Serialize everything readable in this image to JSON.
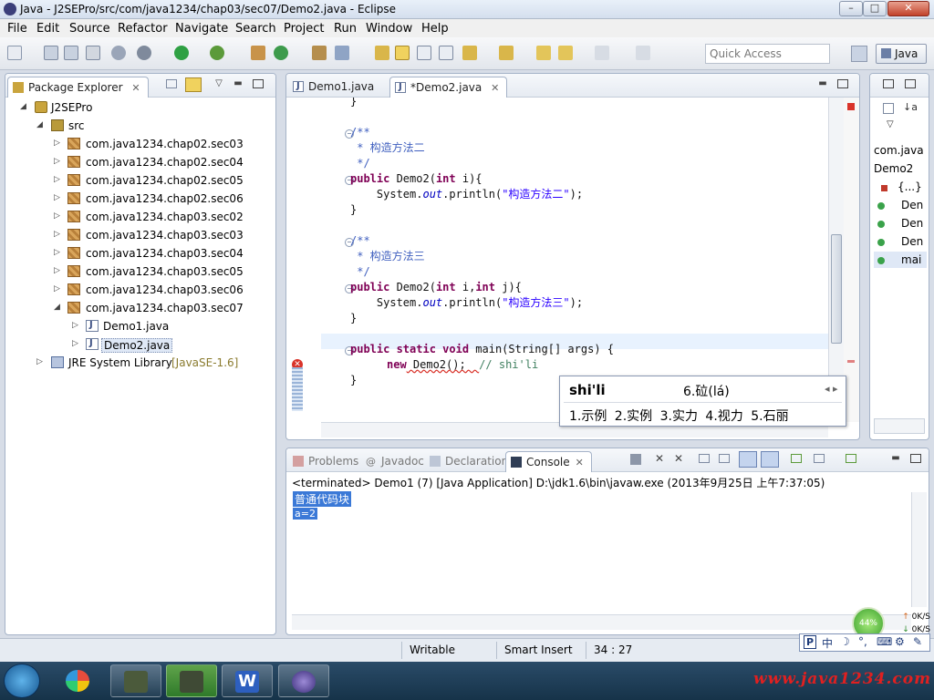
{
  "window": {
    "title": "Java - J2SEPro/src/com/java1234/chap03/sec07/Demo2.java - Eclipse",
    "minimize": "–",
    "maximize": "□",
    "close": "✕"
  },
  "menu": [
    "File",
    "Edit",
    "Source",
    "Refactor",
    "Navigate",
    "Search",
    "Project",
    "Run",
    "Window",
    "Help"
  ],
  "toolbar": {
    "quick_access_placeholder": "Quick Access",
    "perspective": "Java"
  },
  "package_explorer": {
    "tab_label": "Package Explorer",
    "tree": [
      {
        "label": "J2SEPro"
      },
      {
        "label": "src"
      },
      {
        "label": "com.java1234.chap02.sec03"
      },
      {
        "label": "com.java1234.chap02.sec04"
      },
      {
        "label": "com.java1234.chap02.sec05"
      },
      {
        "label": "com.java1234.chap02.sec06"
      },
      {
        "label": "com.java1234.chap03.sec02"
      },
      {
        "label": "com.java1234.chap03.sec03"
      },
      {
        "label": "com.java1234.chap03.sec04"
      },
      {
        "label": "com.java1234.chap03.sec05"
      },
      {
        "label": "com.java1234.chap03.sec06"
      },
      {
        "label": "com.java1234.chap03.sec07"
      },
      {
        "label": "Demo1.java"
      },
      {
        "label": "Demo2.java"
      },
      {
        "label": "JRE System Library",
        "suffix": "[JavaSE-1.6]"
      }
    ]
  },
  "editor": {
    "tabs": [
      {
        "label": "Demo1.java"
      },
      {
        "label": "*Demo2.java"
      }
    ],
    "code": {
      "l1": "}",
      "l2": "/**",
      "l3": " * 构造方法二",
      "l4": " */",
      "l5_kw": "public",
      "l5_rest": " Demo2(",
      "l5_kw2": "int",
      "l5_end": " i){",
      "l6_a": "    System.",
      "l6_f": "out",
      "l6_b": ".println(",
      "l6_s": "\"构造方法二\"",
      "l6_c": ");",
      "l7": "}",
      "l8": "/**",
      "l9": " * 构造方法三",
      "l10": " */",
      "l11_kw": "public",
      "l11_rest": " Demo2(",
      "l11_kw2": "int",
      "l11_mid": " i,",
      "l11_kw3": "int",
      "l11_end": " j){",
      "l12_a": "    System.",
      "l12_f": "out",
      "l12_b": ".println(",
      "l12_s": "\"构造方法三\"",
      "l12_c": ");",
      "l13": "}",
      "l14_kw": "public static void",
      "l14_rest": " main(String[] args) {",
      "l15_kw": "new",
      "l15_rest": " Demo2();  ",
      "l15_cm": "// shi'li",
      "l16": "}"
    }
  },
  "ime": {
    "composition": "shi'li",
    "candidate6": "6.砬(lá)",
    "arrows": "◂ ▸",
    "candidates": "1.示例 2.实例 3.实力 4.视力 5.石丽"
  },
  "outline": {
    "items": [
      "com.java",
      "Demo2",
      "{...}",
      "Den",
      "Den",
      "Den",
      "mai"
    ]
  },
  "console": {
    "tabs": [
      "Problems",
      "Javadoc",
      "Declaration",
      "Console"
    ],
    "info": "<terminated> Demo1 (7) [Java Application] D:\\jdk1.6\\bin\\javaw.exe (2013年9月25日 上午7:37:05)",
    "output": [
      "普通代码块",
      "a=2"
    ]
  },
  "status": {
    "writable": "Writable",
    "insert_mode": "Smart Insert",
    "position": "34 : 27"
  },
  "net": {
    "percent": "44%",
    "up": "0K/S",
    "down": "0K/S"
  },
  "ime_bar": [
    "P",
    "中",
    "☽",
    "°,",
    "⌨",
    "⚙",
    "✎"
  ],
  "watermark": "www.java1234.com",
  "colors": {
    "keyword": "#7f0055",
    "string": "#2a00ff",
    "comment": "#3f5fbf",
    "selection": "#3b79d7"
  }
}
